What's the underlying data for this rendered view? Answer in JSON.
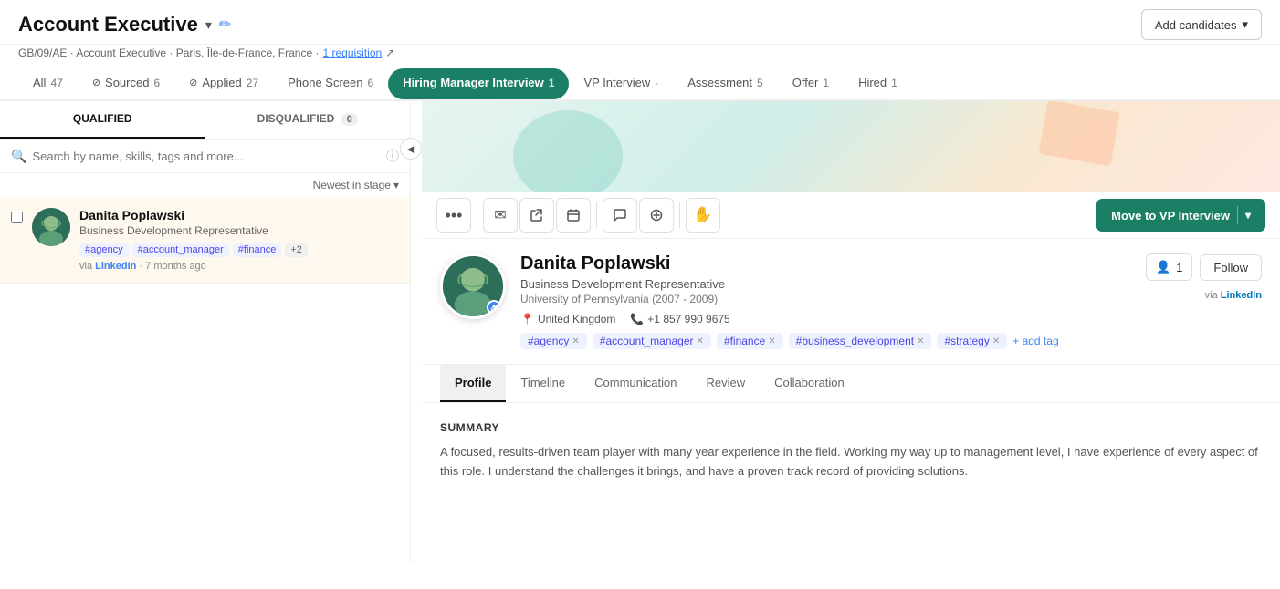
{
  "header": {
    "title": "Account Executive",
    "edit_label": "✏",
    "chevron": "▾",
    "breadcrumb": "GB/09/AE · Account Executive · Paris, Île-de-France, France · ",
    "requisition_link": "1 requisition",
    "add_candidates_label": "Add candidates"
  },
  "stage_tabs": [
    {
      "id": "all",
      "label": "All",
      "count": "47",
      "active": false
    },
    {
      "id": "sourced",
      "label": "Sourced",
      "count": "6",
      "active": false
    },
    {
      "id": "applied",
      "label": "Applied",
      "count": "27",
      "active": false
    },
    {
      "id": "phone-screen",
      "label": "Phone Screen",
      "count": "6",
      "active": false
    },
    {
      "id": "hiring-manager",
      "label": "Hiring Manager Interview",
      "count": "1",
      "active": true
    },
    {
      "id": "vp-interview",
      "label": "VP Interview",
      "count": "-",
      "active": false
    },
    {
      "id": "assessment",
      "label": "Assessment",
      "count": "5",
      "active": false
    },
    {
      "id": "offer",
      "label": "Offer",
      "count": "1",
      "active": false
    },
    {
      "id": "hired",
      "label": "Hired",
      "count": "1",
      "active": false
    }
  ],
  "left_panel": {
    "qualified_tab": "QUALIFIED",
    "disqualified_tab": "DISQUALIFIED",
    "disqualified_count": "0",
    "search_placeholder": "Search by name, skills, tags and more...",
    "sort_label": "Newest in stage",
    "candidates": [
      {
        "name": "Danita Poplawski",
        "title": "Business Development Representative",
        "tags": [
          "#agency",
          "#account_manager",
          "#finance"
        ],
        "extra_tags": "+2",
        "source": "LinkedIn",
        "time_ago": "7 months ago",
        "selected": true
      }
    ]
  },
  "action_toolbar": {
    "dots_icon": "•••",
    "email_icon": "✉",
    "share_icon": "⤴",
    "calendar_icon": "📅",
    "chat_icon": "💬",
    "merge_icon": "⊕",
    "flag_icon": "✋",
    "move_btn_label": "Move to VP Interview",
    "move_btn_caret": "▾"
  },
  "profile": {
    "name": "Danita Poplawski",
    "title": "Business Development Representative",
    "education": "University of Pennsylvania (2007 - 2009)",
    "location": "United Kingdom",
    "phone": "+1 857 990 9675",
    "tags": [
      "#agency",
      "#account_manager",
      "#finance",
      "#business_development",
      "#strategy"
    ],
    "add_tag_label": "+ add tag",
    "followers_count": "1",
    "follow_label": "Follow",
    "via_source": "via LinkedIn",
    "tabs": [
      "Profile",
      "Timeline",
      "Communication",
      "Review",
      "Collaboration"
    ],
    "active_tab": "Profile",
    "summary_title": "SUMMARY",
    "summary_text": "A focused, results-driven team player with many year experience in the field. Working my way up to management level, I have experience of every aspect of this role. I understand the challenges it brings, and have a proven track record of providing solutions."
  },
  "icons": {
    "search": "🔍",
    "info": "ⓘ",
    "location": "📍",
    "phone": "📞",
    "person": "👤",
    "pencil": "✏️",
    "collapse": "◀"
  }
}
